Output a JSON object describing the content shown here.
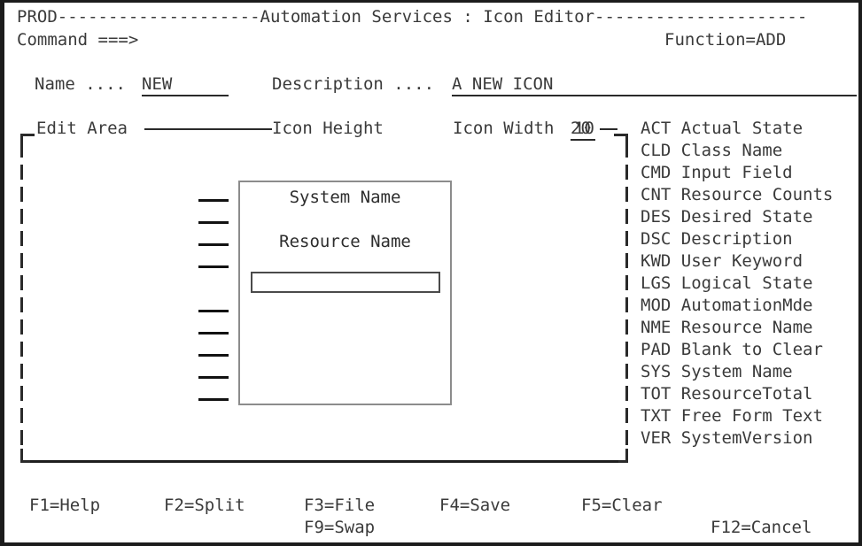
{
  "header": {
    "system_id": "PROD",
    "dashes_left": "--------------------",
    "title": "Automation Services : Icon Editor",
    "dashes_right": "---------------------",
    "command_label": "Command ===>",
    "command_value": "",
    "function_label": "Function=ADD"
  },
  "fields": {
    "name_label": "Name ....",
    "name_value": "NEW",
    "description_label": "Description ....",
    "description_value": "A NEW ICON"
  },
  "edit_area": {
    "label": "Edit Area",
    "icon_height_label": "Icon Height",
    "icon_height_value": "10",
    "icon_width_label": "Icon Width",
    "icon_width_value": "20",
    "row_markers": [
      "____",
      "____",
      "____",
      "____",
      "____",
      "____",
      "____",
      "____",
      "____"
    ]
  },
  "preview": {
    "system_name": "System Name",
    "resource_name": "Resource Name",
    "input_field_value": ""
  },
  "legend": [
    {
      "code": "ACT",
      "description": "Actual State"
    },
    {
      "code": "CLD",
      "description": "Class Name"
    },
    {
      "code": "CMD",
      "description": "Input Field"
    },
    {
      "code": "CNT",
      "description": "Resource Counts"
    },
    {
      "code": "DES",
      "description": "Desired State"
    },
    {
      "code": "DSC",
      "description": "Description"
    },
    {
      "code": "KWD",
      "description": "User Keyword"
    },
    {
      "code": "LGS",
      "description": "Logical State"
    },
    {
      "code": "MOD",
      "description": "AutomationMde"
    },
    {
      "code": "NME",
      "description": "Resource Name"
    },
    {
      "code": "PAD",
      "description": "Blank to Clear"
    },
    {
      "code": "SYS",
      "description": "System Name"
    },
    {
      "code": "TOT",
      "description": "ResourceTotal"
    },
    {
      "code": "TXT",
      "description": "Free Form Text"
    },
    {
      "code": "VER",
      "description": "SystemVersion"
    }
  ],
  "function_keys": {
    "f1": "F1=Help",
    "f2": "F2=Split",
    "f3": "F3=File",
    "f4": "F4=Save",
    "f5": "F5=Clear",
    "f9": "F9=Swap",
    "f12": "F12=Cancel"
  },
  "colors": {
    "text": "#3a3a3a",
    "border": "#1c1c1c",
    "rule": "#2a2a2a",
    "preview_border": "#8c8c8c"
  }
}
